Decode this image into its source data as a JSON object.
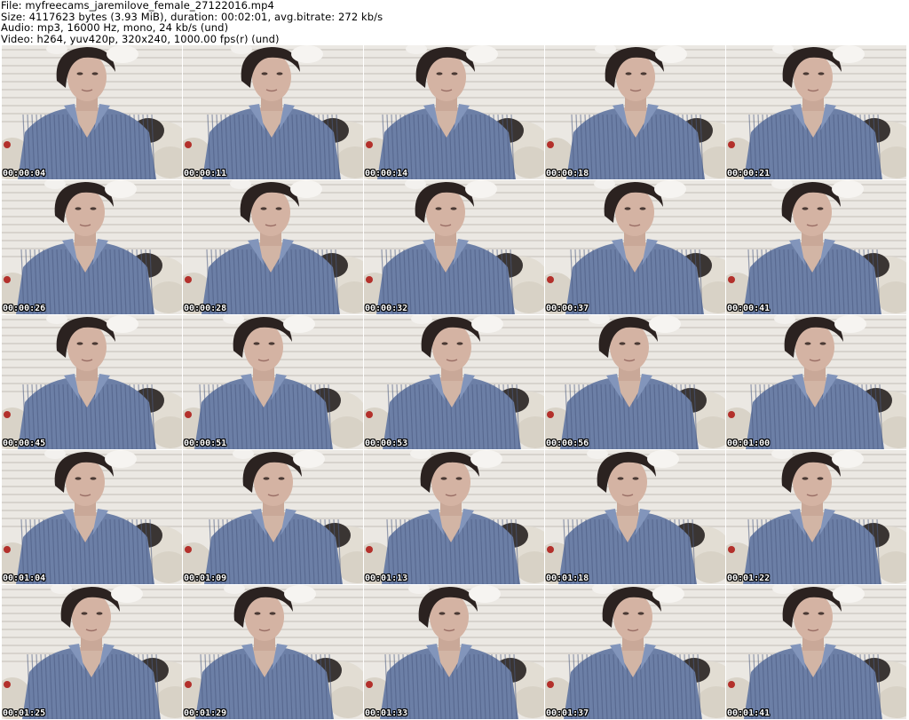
{
  "header": {
    "file_line": "File: myfreecams_jaremilove_female_27122016.mp4",
    "size_line": "Size: 4117623 bytes (3.93 MiB), duration: 00:02:01, avg.bitrate: 272 kb/s",
    "audio_line": "Audio: mp3, 16000 Hz, mono, 24 kb/s (und)",
    "video_line": "Video: h264, yuv420p, 320x240, 1000.00 fps(r) (und)"
  },
  "thumbnails": [
    {
      "time": "00:00:04"
    },
    {
      "time": "00:00:11"
    },
    {
      "time": "00:00:14"
    },
    {
      "time": "00:00:18"
    },
    {
      "time": "00:00:21"
    },
    {
      "time": "00:00:26"
    },
    {
      "time": "00:00:28"
    },
    {
      "time": "00:00:32"
    },
    {
      "time": "00:00:37"
    },
    {
      "time": "00:00:41"
    },
    {
      "time": "00:00:45"
    },
    {
      "time": "00:00:51"
    },
    {
      "time": "00:00:53"
    },
    {
      "time": "00:00:56"
    },
    {
      "time": "00:01:00"
    },
    {
      "time": "00:01:04"
    },
    {
      "time": "00:01:09"
    },
    {
      "time": "00:01:13"
    },
    {
      "time": "00:01:18"
    },
    {
      "time": "00:01:22"
    },
    {
      "time": "00:01:25"
    },
    {
      "time": "00:01:29"
    },
    {
      "time": "00:01:33"
    },
    {
      "time": "00:01:37"
    },
    {
      "time": "00:01:41"
    }
  ],
  "colors": {
    "background": "#ffffff",
    "timestamp_text": "#ffffff",
    "timestamp_outline": "#000000"
  }
}
